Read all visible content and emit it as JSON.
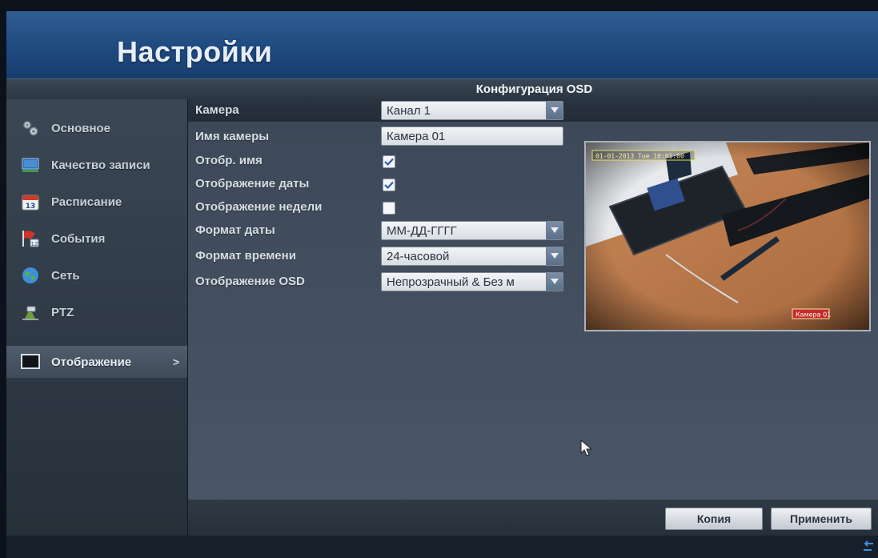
{
  "header": {
    "title": "Настройки"
  },
  "section": {
    "title": "Конфигурация OSD"
  },
  "sidebar": {
    "items": [
      {
        "label": "Основное"
      },
      {
        "label": "Качество записи"
      },
      {
        "label": "Расписание"
      },
      {
        "label": "События"
      },
      {
        "label": "Сеть"
      },
      {
        "label": "PTZ"
      },
      {
        "label": "Отображение",
        "active": true,
        "arrow": ">"
      }
    ]
  },
  "form": {
    "camera": {
      "label": "Камера",
      "value": "Канал 1"
    },
    "camera_name": {
      "label": "Имя камеры",
      "value": "Камера 01"
    },
    "show_name": {
      "label": "Отобр. имя",
      "checked": true
    },
    "show_date": {
      "label": "Отображение даты",
      "checked": true
    },
    "show_week": {
      "label": "Отображение недели",
      "checked": false
    },
    "date_format": {
      "label": "Формат даты",
      "value": "ММ-ДД-ГГГГ"
    },
    "time_format": {
      "label": "Формат времени",
      "value": "24-часовой"
    },
    "osd_display": {
      "label": "Отображение OSD",
      "value": "Непрозрачный & Без м"
    }
  },
  "preview": {
    "date_overlay": "01-01-2013 Tue 10:01:00",
    "name_overlay": "Камера 01"
  },
  "buttons": {
    "copy": "Копия",
    "apply": "Применить"
  },
  "colors": {
    "header": "#1f4a80",
    "accent": "#5a6f88",
    "panel": "#4a5666"
  }
}
